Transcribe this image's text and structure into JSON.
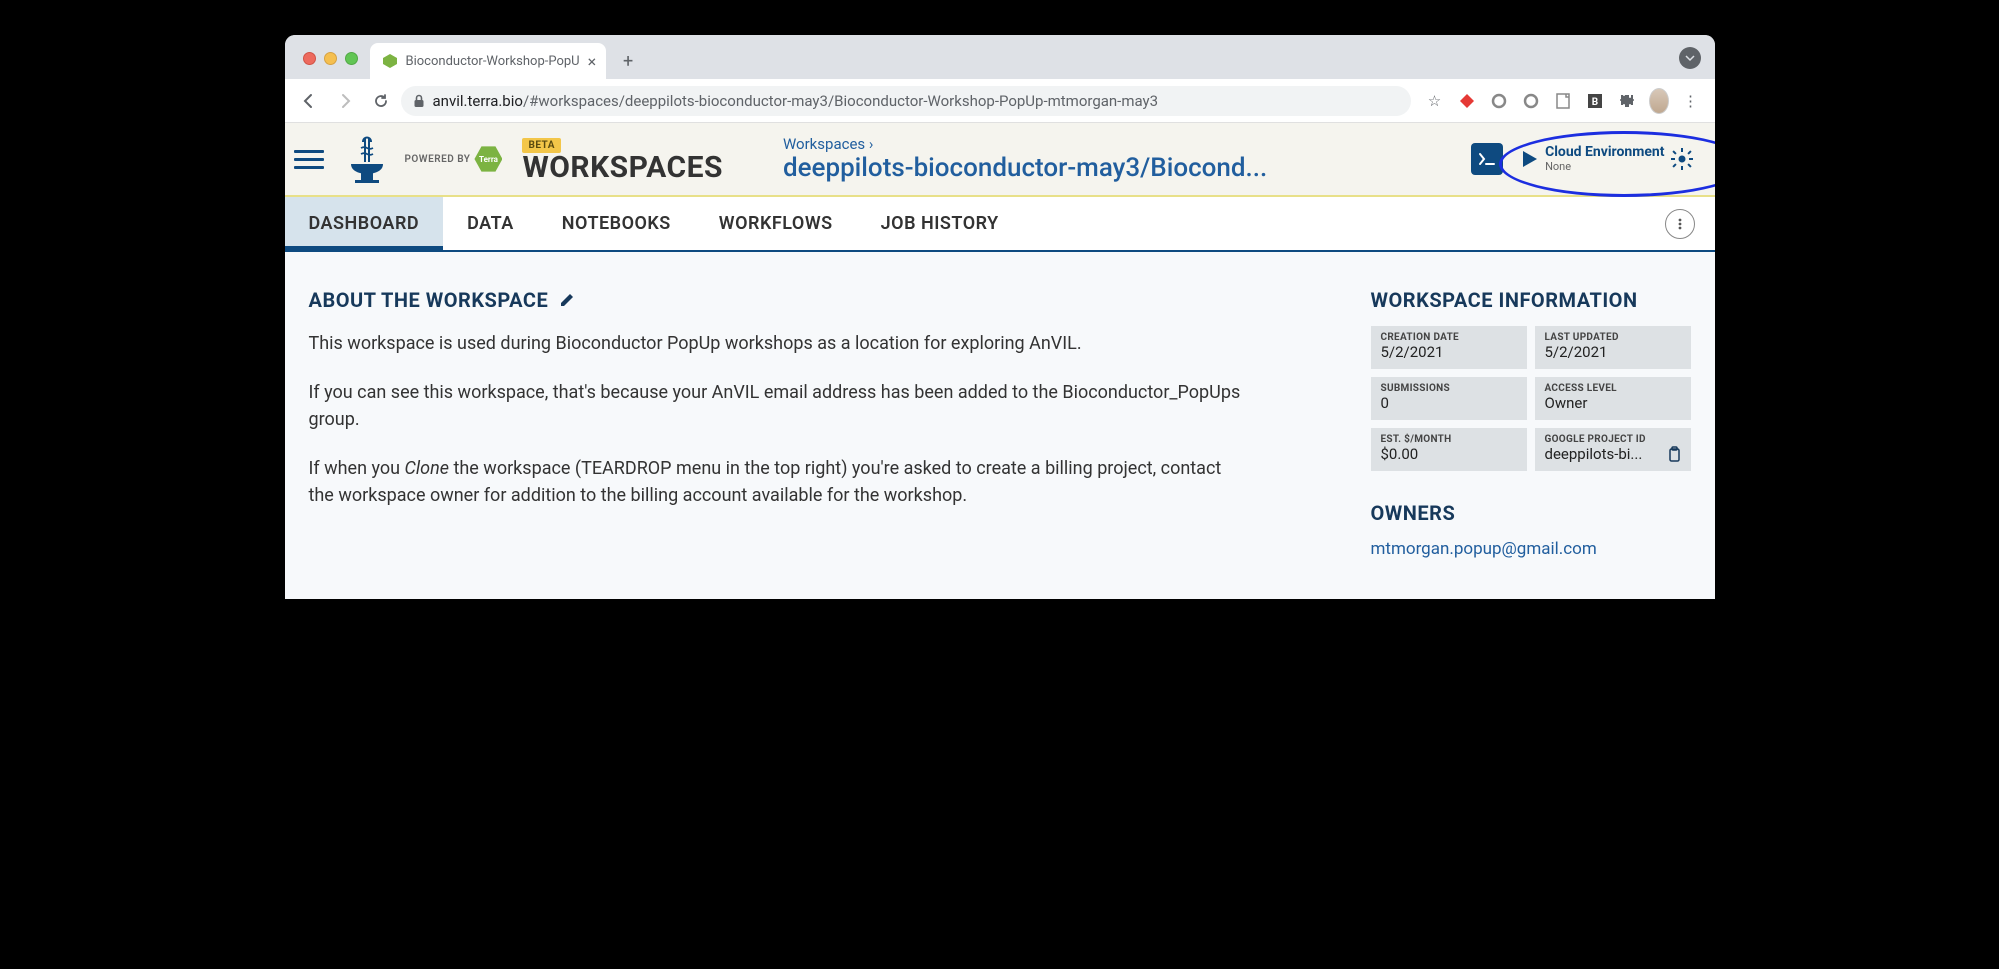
{
  "browser": {
    "tab_title": "Bioconductor-Workshop-PopU",
    "url_domain": "anvil.terra.bio",
    "url_path": "/#workspaces/deeppilots-bioconductor-may3/Bioconductor-Workshop-PopUp-mtmorgan-may3"
  },
  "header": {
    "powered_by": "POWERED BY",
    "beta": "BETA",
    "workspaces_title": "WORKSPACES",
    "breadcrumb_top": "Workspaces ›",
    "breadcrumb_main": "deeppilots-bioconductor-may3/Biocond...",
    "cloud_env_label": "Cloud Environment",
    "cloud_env_status": "None"
  },
  "tabs": {
    "items": [
      "DASHBOARD",
      "DATA",
      "NOTEBOOKS",
      "WORKFLOWS",
      "JOB HISTORY"
    ],
    "active_index": 0
  },
  "about": {
    "heading": "ABOUT THE WORKSPACE",
    "p1": "This workspace is used during Bioconductor PopUp workshops as a location for exploring AnVIL.",
    "p2": "If you can see this workspace, that's because your AnVIL email address has been added to the Bioconductor_PopUps group.",
    "p3_a": "If when you ",
    "p3_em": "Clone",
    "p3_b": " the workspace (TEARDROP menu in the top right) you're asked to create a billing project, contact the workspace owner for addition to the billing account available for the workshop."
  },
  "info": {
    "heading": "WORKSPACE INFORMATION",
    "creation_date_label": "CREATION DATE",
    "creation_date": "5/2/2021",
    "last_updated_label": "LAST UPDATED",
    "last_updated": "5/2/2021",
    "submissions_label": "SUBMISSIONS",
    "submissions": "0",
    "access_level_label": "ACCESS LEVEL",
    "access_level": "Owner",
    "est_cost_label": "EST. $/MONTH",
    "est_cost": "$0.00",
    "project_id_label": "GOOGLE PROJECT ID",
    "project_id": "deeppilots-bi..."
  },
  "owners": {
    "heading": "OWNERS",
    "list": [
      "mtmorgan.popup@gmail.com"
    ]
  }
}
